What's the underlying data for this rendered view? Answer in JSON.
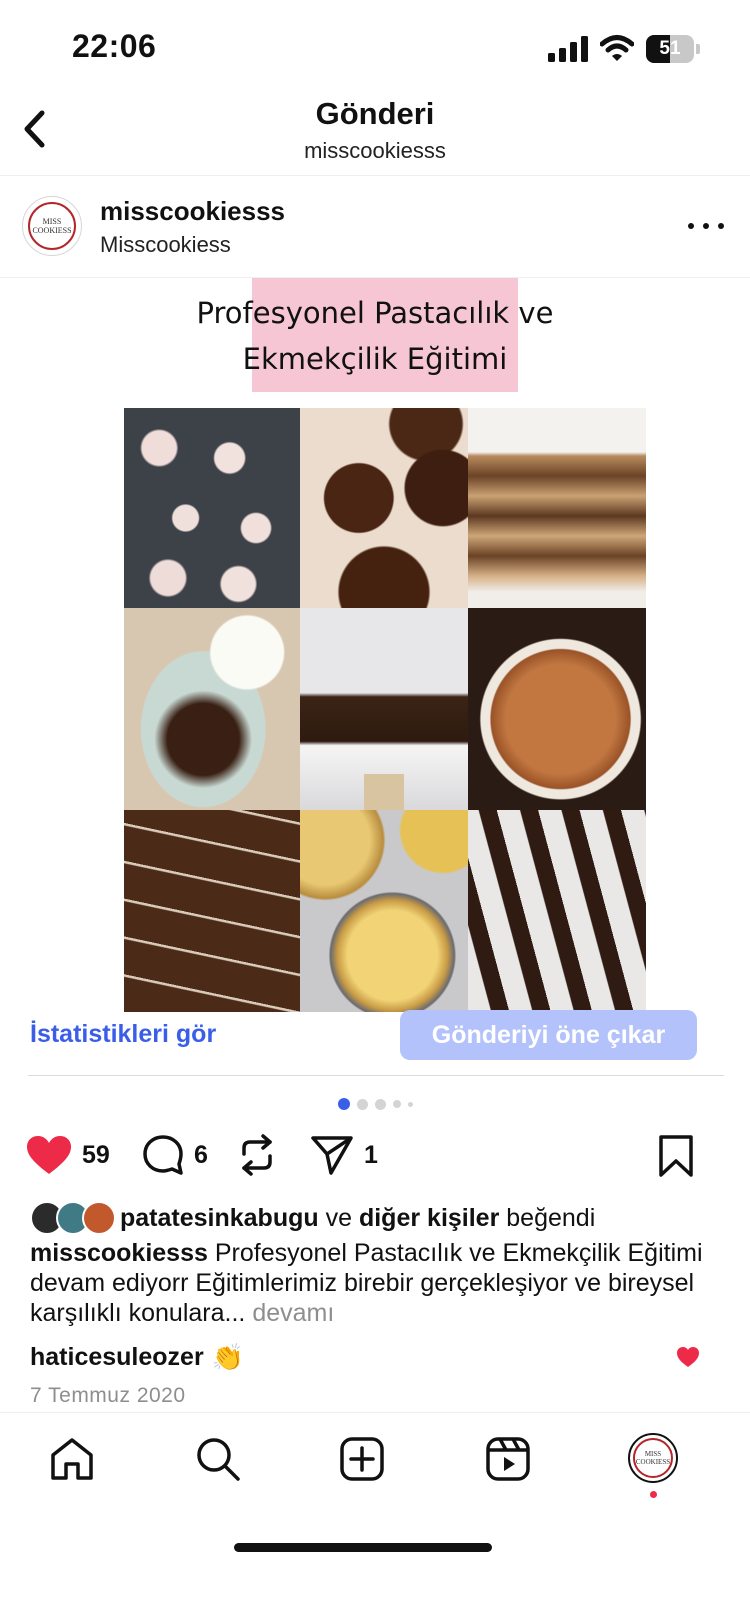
{
  "status_bar": {
    "time": "22:06",
    "battery": "51",
    "battery_level_pct": 51
  },
  "header": {
    "title": "Gönderi",
    "subtitle": "misscookiesss"
  },
  "post": {
    "username": "misscookiesss",
    "full_name": "Misscookiess",
    "avatar_text": "MISS COOKIESS",
    "media_title_line1": "Profesyonel Pastacılık ve",
    "media_title_line2": "Ekmekçilik Eğitimi",
    "highlight_color": "#f7c6d4"
  },
  "insights": {
    "link_label": "İstatistikleri gör",
    "boost_label": "Gönderiyi öne çıkar",
    "link_color": "#3a5ee8",
    "boost_color": "#b4c2fb"
  },
  "carousel": {
    "current_index": 1,
    "total": 5
  },
  "actions": {
    "likes": "59",
    "comments": "6",
    "shares": "1",
    "like_color": "#ed2a47"
  },
  "liked_by": {
    "user": "patatesinkabugu",
    "connector": "ve",
    "others": "diğer kişiler",
    "suffix": "beğendi"
  },
  "caption": {
    "username": "misscookiesss",
    "text": "Profesyonel Pastacılık ve Ekmekçilik Eğitimi devam ediyorr Eğitimlerimiz birebir gerçekleşiyor ve bireysel karşılıklı konulara...",
    "more": "devamı"
  },
  "comment": {
    "username": "haticesuleozer",
    "emoji": "👏"
  },
  "date": "7 Temmuz 2020",
  "tab_bar": {
    "items": [
      "home-icon",
      "search-icon",
      "create-icon",
      "reels-icon",
      "profile-avatar"
    ]
  }
}
